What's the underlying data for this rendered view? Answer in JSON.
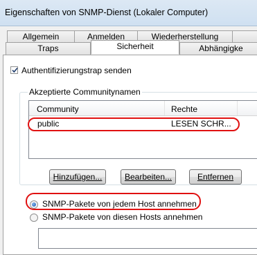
{
  "window": {
    "title": "Eigenschaften von SNMP-Dienst (Lokaler Computer)"
  },
  "tabs": {
    "row_back": [
      "Allgemein",
      "Anmelden",
      "Wiederherstellung",
      ""
    ],
    "row_front": [
      "Traps",
      "Sicherheit",
      "Abhängigke"
    ],
    "active": "Sicherheit"
  },
  "security": {
    "auth_trap_label": "Authentifizierungstrap senden",
    "auth_trap_checked": true,
    "group_label": "Akzeptierte Communitynamen",
    "columns": [
      "Community",
      "Rechte"
    ],
    "rows": [
      {
        "community": "public",
        "rights": "LESEN SCHR..."
      }
    ],
    "buttons": {
      "add": "Hinzufügen...",
      "edit": "Bearbeiten...",
      "remove": "Entfernen"
    },
    "radio_any_host": "SNMP-Pakete von jedem Host annehmen",
    "radio_these_hosts": "SNMP-Pakete von diesen Hosts annehmen",
    "selected_radio": "any_host"
  },
  "colors": {
    "highlight": "#e01010",
    "radio_dot": "#1a58b5",
    "window_bg": "#f0f0f0"
  }
}
